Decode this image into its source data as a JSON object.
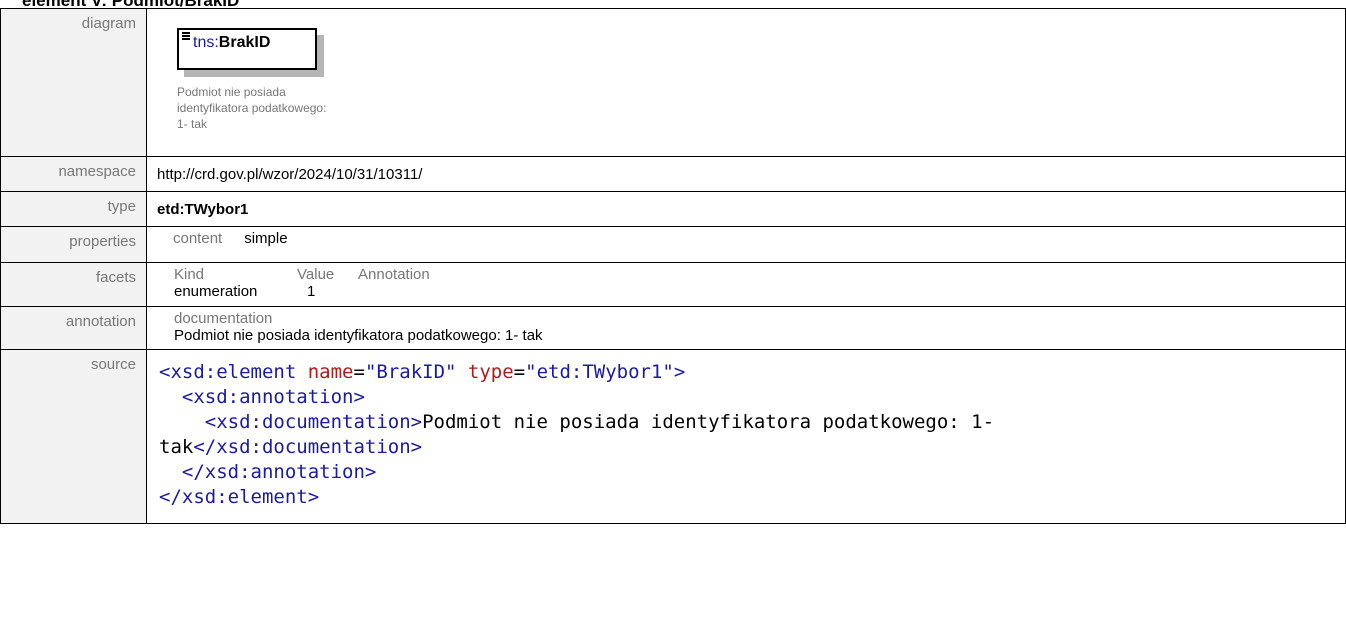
{
  "heading": "element V: Podmiot/BrakID",
  "labels": {
    "diagram": "diagram",
    "namespace": "namespace",
    "type": "type",
    "properties": "properties",
    "facets": "facets",
    "annotation": "annotation",
    "source": "source"
  },
  "diagram": {
    "element_prefix": "tns:",
    "element_name": "BrakID",
    "annotation_lines": [
      "Podmiot nie posiada",
      "identyfikatora podatkowego:",
      "1- tak"
    ]
  },
  "namespace": "http://crd.gov.pl/wzor/2024/10/31/10311/",
  "type": "etd:TWybor1",
  "properties": {
    "key": "content",
    "value": "simple"
  },
  "facets": {
    "headers": [
      "Kind",
      "Value",
      "Annotation"
    ],
    "rows": [
      {
        "kind": "enumeration",
        "value": "1",
        "annotation": ""
      }
    ]
  },
  "annotation": {
    "key": "documentation",
    "text": "Podmiot nie posiada identyfikatora podatkowego: 1- tak"
  },
  "source": {
    "line1_open": "<xsd:element ",
    "line1_attr1": "name",
    "line1_eq1": "=",
    "line1_val1": "\"BrakID\"",
    "line1_attr2": "type",
    "line1_eq2": "=",
    "line1_val2": "\"etd:TWybor1\"",
    "line1_close": ">",
    "line2": "<xsd:annotation>",
    "line3_open": "<xsd:documentation>",
    "line3_text": "Podmiot nie posiada identyfikatora podatkowego: 1-",
    "line4_text": "tak",
    "line4_close": "</xsd:documentation>",
    "line5": "</xsd:annotation>",
    "line6": "</xsd:element>"
  },
  "colors": {
    "tag": "#1a1aa6",
    "attribute": "#b21a1a",
    "label_bg": "#f2f2f2",
    "label_text": "#777777"
  }
}
